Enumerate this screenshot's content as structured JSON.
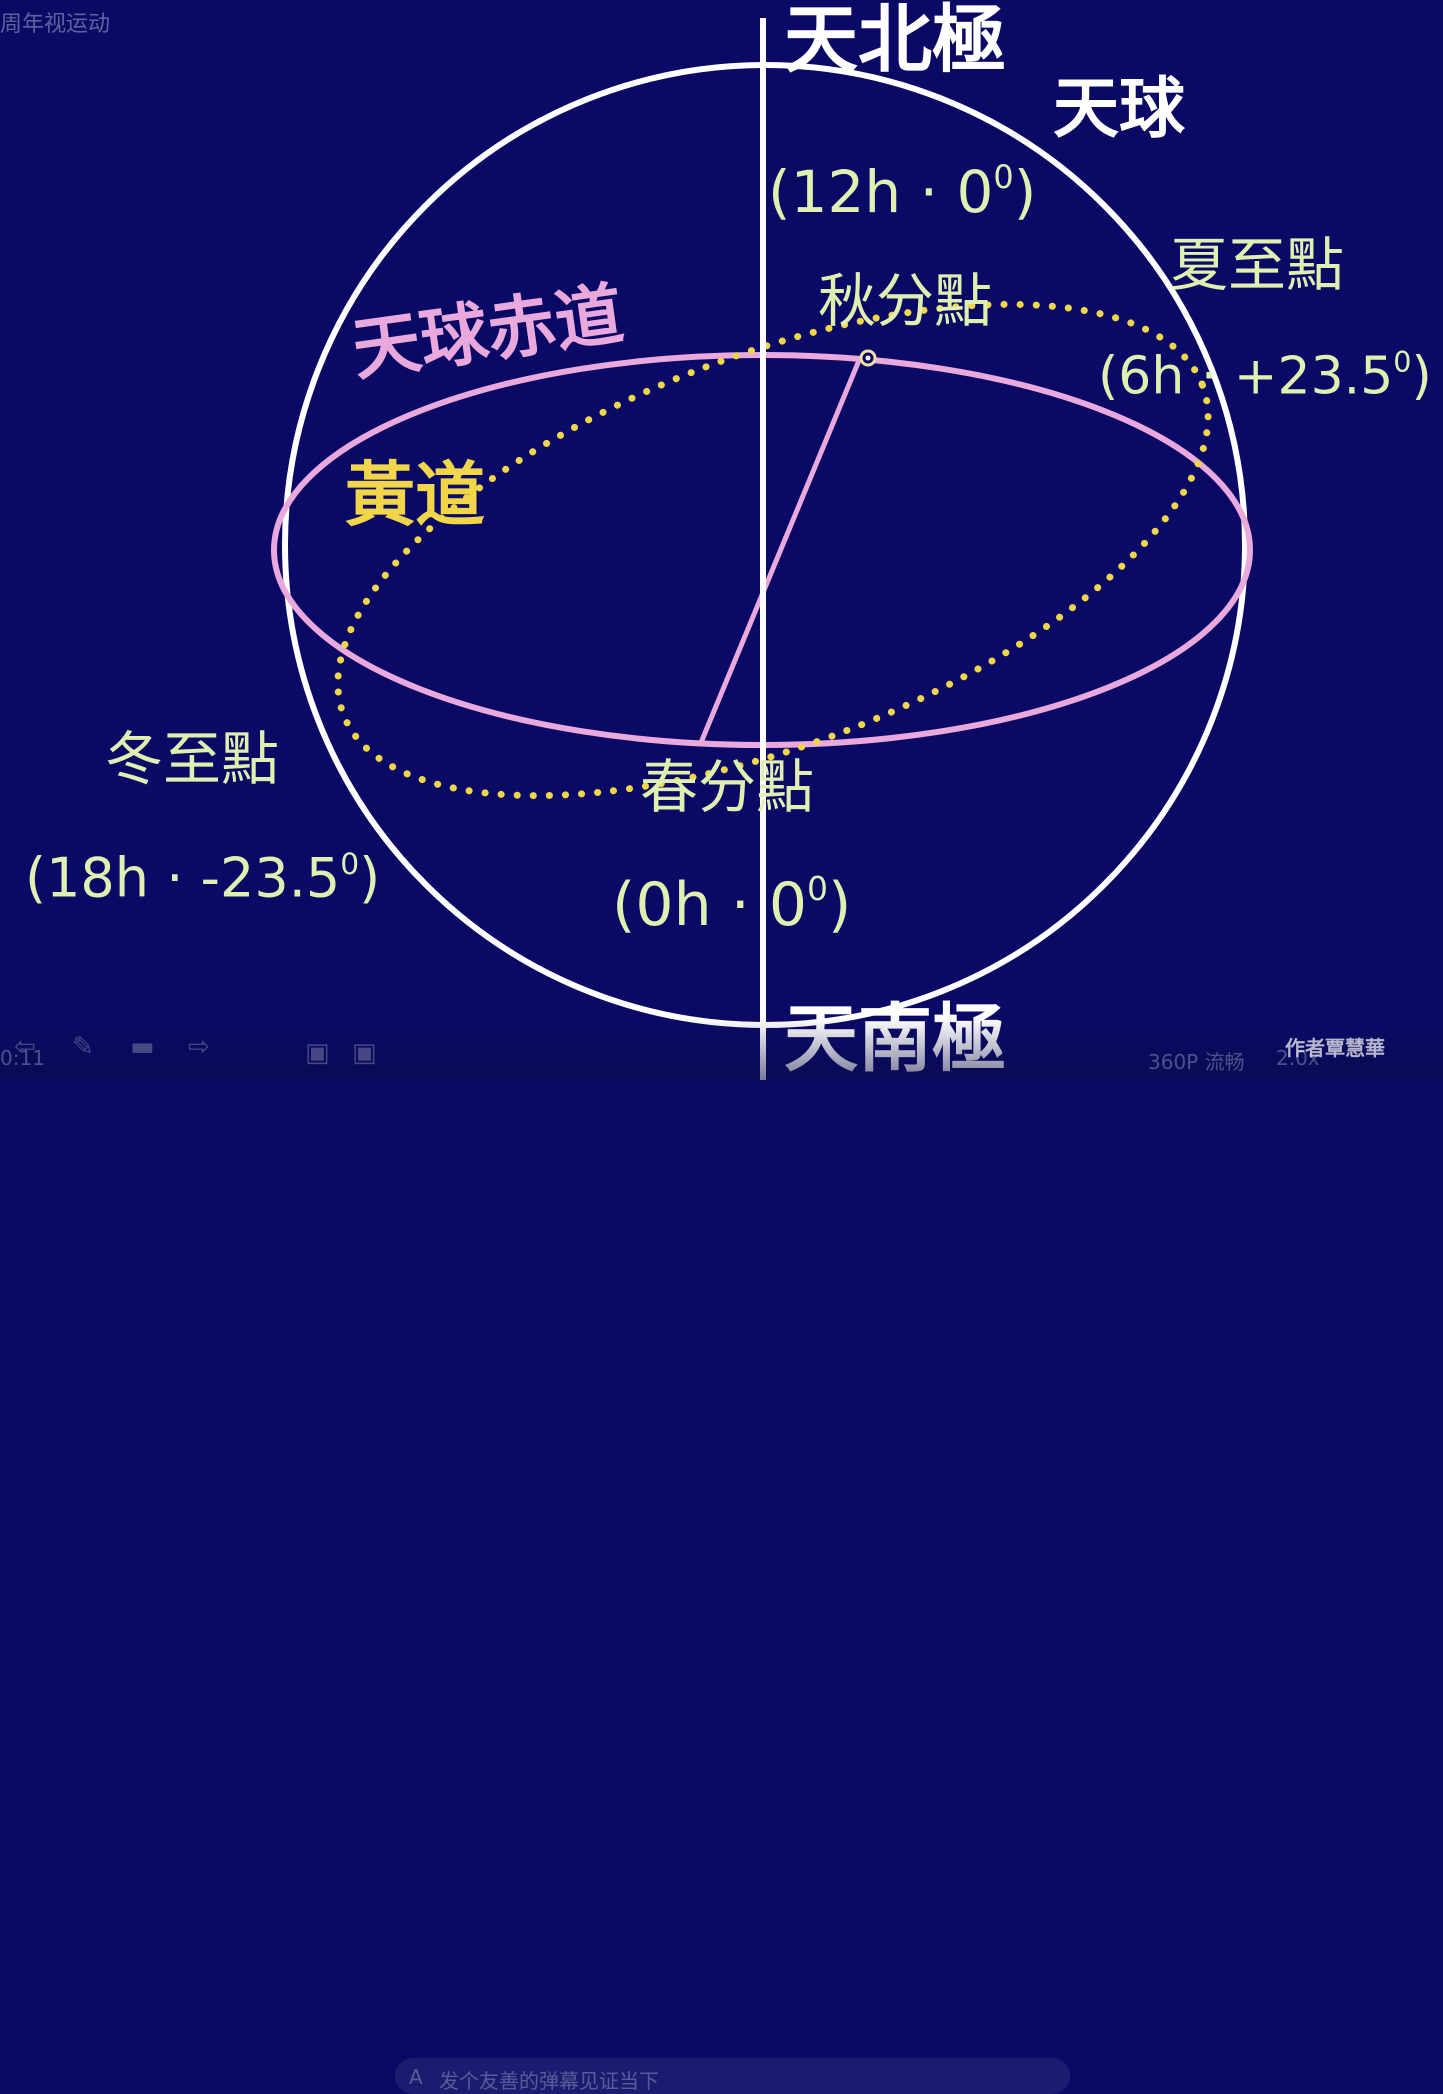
{
  "video": {
    "title": "周年视运动",
    "time": "0:11",
    "comment_placeholder": "发个友善的弹幕见证当下",
    "quality": "360P 流畅",
    "speed": "2.0x",
    "author": "作者覃慧華"
  },
  "diagram": {
    "north_pole": "天北極",
    "celestial_sphere": "天球",
    "autumn_coord": [
      "(12h",
      "0",
      ")"
    ],
    "summer_solstice": "夏至點",
    "autumn_equinox": "秋分點",
    "summer_coord": [
      "(6h",
      "+23.5",
      ")"
    ],
    "celestial_equator": "天球赤道",
    "ecliptic": "黃道",
    "winter_solstice": "冬至點",
    "winter_coord": [
      "(18h",
      "-23.5",
      ")"
    ],
    "spring_equinox": "春分點",
    "spring_coord": [
      "(0h",
      "0",
      ")"
    ],
    "south_pole": "天南極",
    "degree_mark": "0",
    "separator": "·",
    "colors": {
      "background": "#0a0a66",
      "sphere": "#ffffff",
      "equator": "#e9a9dc",
      "ecliptic": "#f2d64a",
      "label": "#dff0b0"
    }
  }
}
